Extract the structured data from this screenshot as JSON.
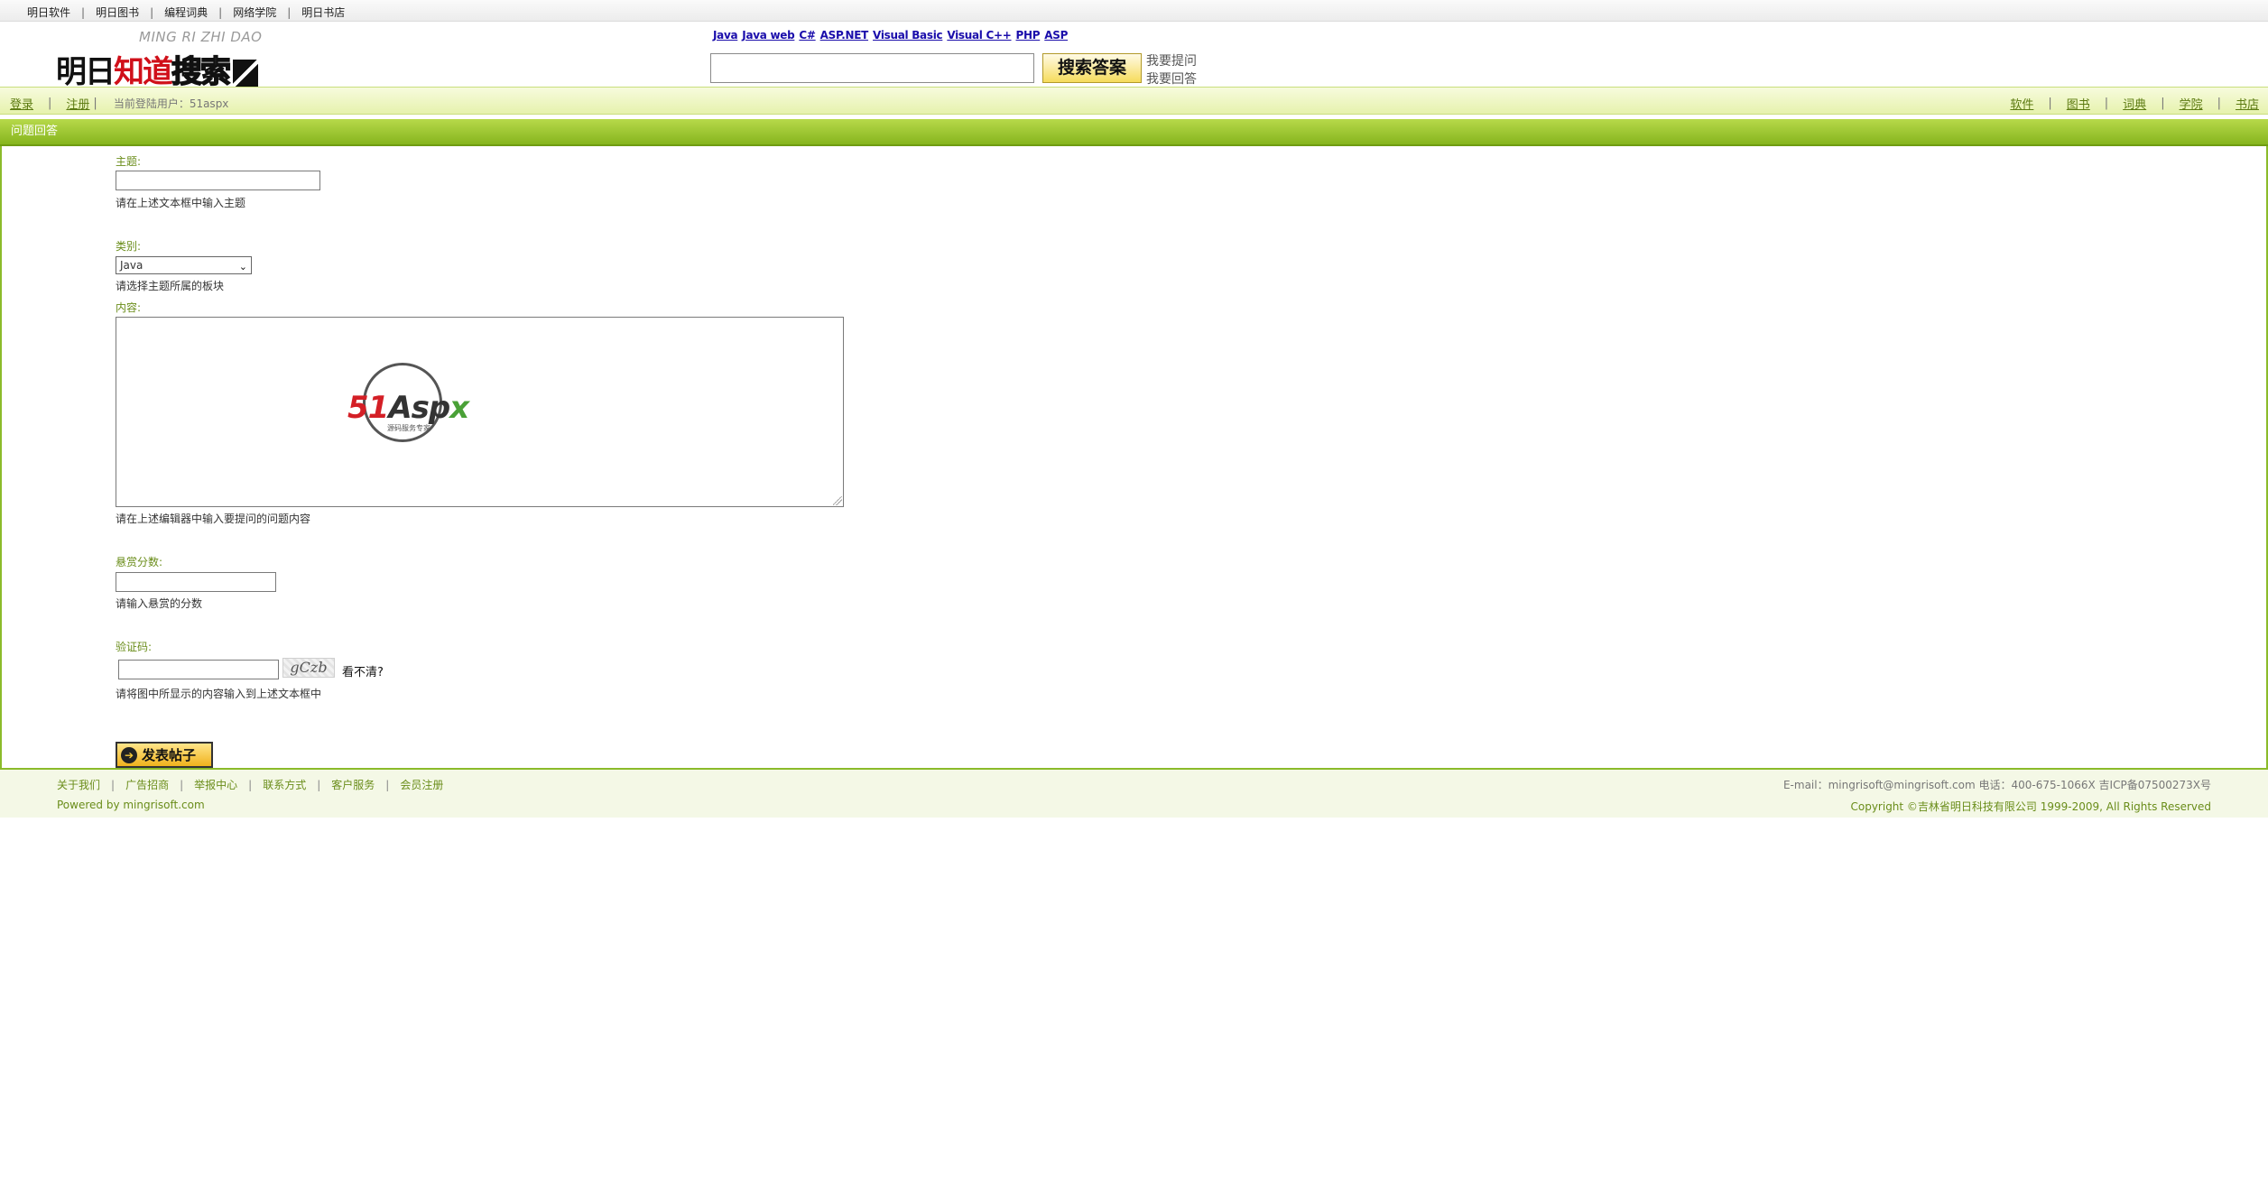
{
  "top_nav": [
    "明日软件",
    "明日图书",
    "编程词典",
    "网络学院",
    "明日书店"
  ],
  "header": {
    "logo_sub": "MING RI ZHI DAO",
    "logo_main_1": "明日",
    "logo_main_2": "知道",
    "logo_main_3": "搜索",
    "quick_categories": [
      "Java",
      "Java web",
      "C#",
      "ASP.NET",
      "Visual Basic",
      "Visual C++",
      "PHP",
      "ASP"
    ],
    "search_value": "",
    "search_button": "搜索答案",
    "ask_link": "我要提问",
    "answer_link": "我要回答"
  },
  "user_bar": {
    "login": "登录",
    "register": "注册",
    "current_user_label": "当前登陆用户：51aspx",
    "right_links": [
      "软件",
      "图书",
      "词典",
      "学院",
      "书店"
    ]
  },
  "section_title": "问题回答",
  "form": {
    "subject_label": "主题:",
    "subject_value": "",
    "subject_hint": "请在上述文本框中输入主题",
    "category_label": "类别:",
    "category_selected": "Java",
    "category_hint": "请选择主题所属的板块",
    "content_label": "内容:",
    "content_value": "",
    "content_hint": "请在上述编辑器中输入要提问的问题内容",
    "reward_label": "悬赏分数:",
    "reward_value": "",
    "reward_hint": "请输入悬赏的分数",
    "captcha_label": "验证码:",
    "captcha_value": "",
    "captcha_image_text": "gCzb",
    "captcha_refresh": "看不清?",
    "captcha_hint": "请将图中所显示的内容输入到上述文本框中",
    "submit_label": "发表帖子"
  },
  "watermark": {
    "brand_red": "51",
    "brand_dark": "As",
    "brand_dark2": "p",
    "brand_green": "x",
    "tagline": "源码服务专家"
  },
  "footer": {
    "links": [
      "关于我们",
      "广告招商",
      "举报中心",
      "联系方式",
      "客户服务",
      "会员注册"
    ],
    "powered": "Powered by mingrisoft.com",
    "contact": "E-mail：mingrisoft@mingrisoft.com  电话：400-675-1066X  吉ICP备07500273X号",
    "copyright": "Copyright ©吉林省明日科技有限公司 1999-2009, All Rights Reserved"
  }
}
